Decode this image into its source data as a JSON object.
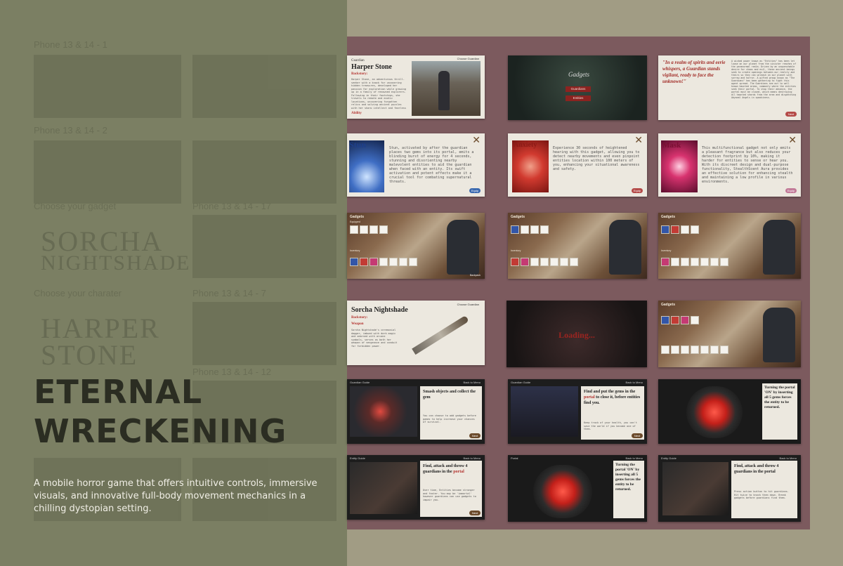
{
  "project": {
    "title_line1": "ETERNAL",
    "title_line2": "WRECKENING",
    "description": "A mobile horror game that offers intuitive controls, immersive visuals, and innovative full-body movement mechanics in a chilling dystopian setting."
  },
  "ghost_labels": [
    "Phone 13 & 14 - 1",
    "Phone 13 & 14 - 2",
    "Choose your gadget",
    "Phone 13 & 14 - 17",
    "Choose your charater",
    "Phone 13 & 14 - 7",
    "Phone 13 & 14 - 12"
  ],
  "ghost_big_text": [
    "SORCHA",
    "NIGHTSHADE",
    "HARPER",
    "STONE"
  ],
  "screens": {
    "harper": {
      "subtitle": "Guardian",
      "name": "Harper Stone",
      "backstory_label": "Backstory:",
      "body": "Harper Stone, an adventurous thrill-seeker with a knack for uncovering hidden treasures, developed her passion for exploration while growing up in a family of renowned explorers. Following in their footsteps, she travels to remote and exotic locations, uncovering forgotten relics and solving ancient puzzles with her sharp intellect and fearless determination.",
      "ability_label": "Ability",
      "nav": "Choose Guardian"
    },
    "menu": {
      "logo": "Gadgets",
      "guardians": "Guardians",
      "entities": "Entities"
    },
    "lore": {
      "quote": "\"In a realm of spirits and eerie whispers, a Guardian stands vigilant, ready to face the unknown!\"",
      "body": "A wicked power known as \"Entities\" has been let loose on our planet from the sinister reaches of the paranormal realm. Driven by an unquenchable desire for chaos and evil, these ancient beings seek to create openings between our reality and theirs so they can unleash on our planet with sorrow and horror. A gifted group known as \"The Guardians\" has been gathering to fight this agent spread. The Guardians see out to well known haunted areas, commonly where the entities seek their portal. To stop their advance, the portal must be closed, which means destroying all haunted shards from the area and dispatching Abysmal Angels in spookiness.",
      "btn": "Next"
    },
    "stun": {
      "title": "Stun",
      "body": "Stun, activated by after the guardian places two gems into its portal, emits a blinding burst of energy for 4 seconds, stunning and disorienting nearby malevolent entities to aid the guardian when faced with an entity. Its swift activation and potent effects make it a crucial tool for combating supernatural threats.",
      "btn": "Equip"
    },
    "anxiety": {
      "title": "Anxiety",
      "body": "Experience 30 seconds of heightened hearing with this gadget, allowing you to detect nearby movements and even pinpoint entities location within 100 meters of you, enhancing your situational awareness and safety.",
      "btn": "Equip"
    },
    "mask": {
      "title": "Mask",
      "body": "This multifunctional gadget not only emits a pleasant fragrance but also reduces your detection footprint by 10%, making it harder for entities to sense or hear you. With its discreet design and dual-purpose functionality, StealthScent Aura provides an effective solution for enhancing stealth and maintaining a low profile in various environments.",
      "btn": "Equip"
    },
    "gadgets": {
      "label": "Gadgets",
      "equipped": "Equipped",
      "inventory": "Inventory",
      "nav": "Backpack"
    },
    "sorcha": {
      "name": "Sorcha Nightshade",
      "backstory_label": "Backstory:",
      "weapon_label": "Weapon",
      "body": "Sorcha Nightshade's ceremonial dagger, imbued with dark magic and adorned with arcane symbols, serves as both her weapon of vengeance and conduit for forbidden power.",
      "nav": "Choose Guardian"
    },
    "loading": {
      "text": "Loading..."
    },
    "guide1": {
      "header": "Guardian Guide",
      "back": "Back to Menu",
      "title": "Smash objects and collect the gem",
      "body": "You can choose to add gadgets before games to help increase your chances of survival.",
      "btn": "Next"
    },
    "guide2": {
      "header": "Guardian Guide",
      "back": "Back to Menu",
      "title_a": "Find and put the gems in the ",
      "highlight": "portal",
      "title_b": " to close it, before entities find you.",
      "body": "Keep track of your health, you can't save the world if you become one of them.",
      "btn": "Next"
    },
    "portal_turn": {
      "text": "Turning the portal 'ON' by inserting all 5 gems forces the entity to be returned."
    },
    "entity1": {
      "header": "Entity Guide",
      "back": "Back to Menu",
      "title_a": "Find, attack and throw 4 guardians in the ",
      "highlight": "portal",
      "body": "Over time, Entities become stronger and faster. You may be 'immortal' however guardians can use gadgets to impair you.",
      "btn": "Next"
    },
    "portal2": {
      "header": "Portal",
      "back": "Back to Menu",
      "text": "Turning the portal 'ON' by inserting all 5 gems forces the entity to be returned."
    },
    "entity2": {
      "header": "Entity Guide",
      "back": "Back to Menu",
      "title": "Find, attack and throw 4 guardians in the portal",
      "body": "Press action button to hit guardians. Hit twice to knock them down. Break gadgets before guardians find them."
    }
  },
  "colors": {
    "left_bg": "#7b7f63",
    "right_bg": "#a19c84",
    "board": "#7c5a5e",
    "title": "#2b2d22",
    "accent_red": "#b3332f"
  }
}
